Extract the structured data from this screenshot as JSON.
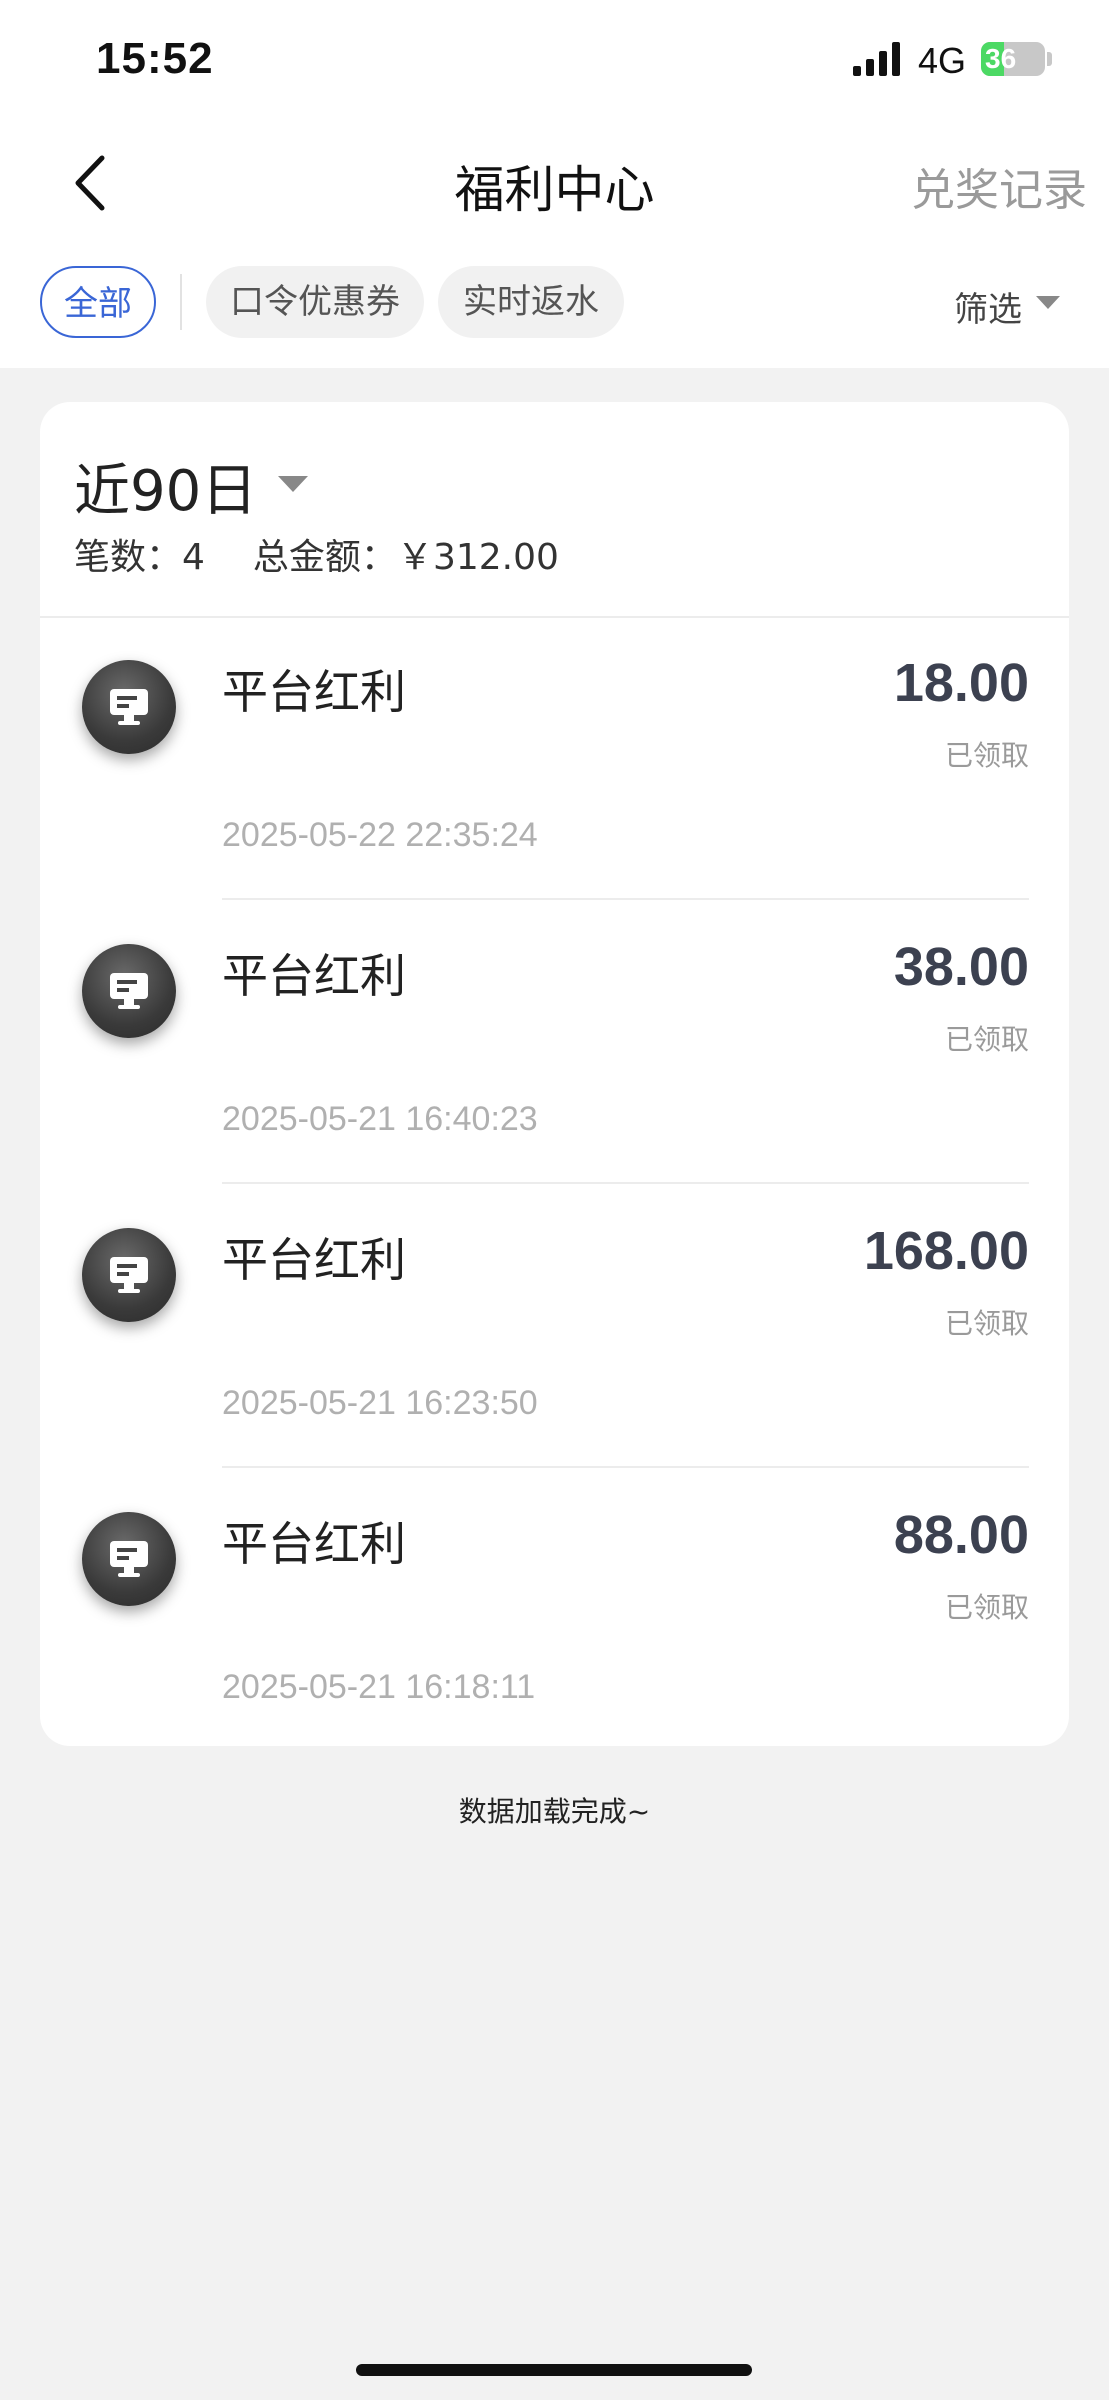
{
  "status_bar": {
    "time": "15:52",
    "network": "4G",
    "battery": "36",
    "battery_level": 0.36
  },
  "nav": {
    "title": "福利中心",
    "right_label": "兑奖记录"
  },
  "filters": {
    "tabs": [
      {
        "label": "全部",
        "active": true
      },
      {
        "label": "口令优惠券",
        "active": false
      },
      {
        "label": "实时返水",
        "active": false
      }
    ],
    "filter_label": "筛选"
  },
  "summary": {
    "period": "近90日",
    "count_label": "笔数：",
    "count": "4",
    "total_label": "总金额：",
    "total": "￥312.00"
  },
  "records": [
    {
      "title": "平台红利",
      "amount": "18.00",
      "status": "已领取",
      "time": "2025-05-22 22:35:24"
    },
    {
      "title": "平台红利",
      "amount": "38.00",
      "status": "已领取",
      "time": "2025-05-21 16:40:23"
    },
    {
      "title": "平台红利",
      "amount": "168.00",
      "status": "已领取",
      "time": "2025-05-21 16:23:50"
    },
    {
      "title": "平台红利",
      "amount": "88.00",
      "status": "已领取",
      "time": "2025-05-21 16:18:11"
    }
  ],
  "footer": {
    "loaded_text": "数据加载完成~"
  },
  "icons": {
    "back": "chevron-left-icon",
    "caret": "caret-down-icon",
    "record": "monitor-icon"
  },
  "colors": {
    "accent": "#3a66d6",
    "amount": "#3c4150",
    "muted": "#9a9a9a",
    "battery": "#4cd964"
  }
}
